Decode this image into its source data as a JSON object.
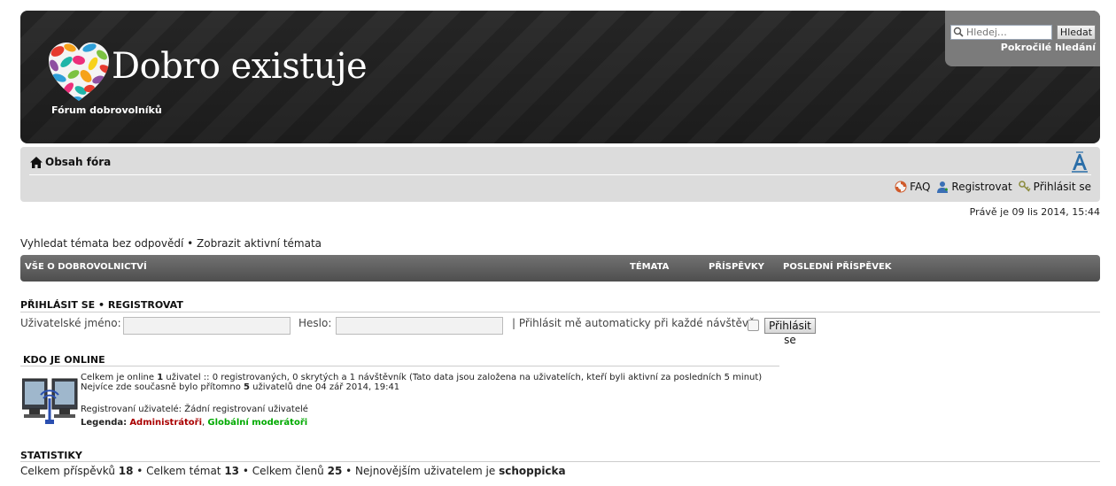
{
  "header": {
    "site_title": "Dobro existuje",
    "site_description": "Fórum dobrovolníků",
    "logo_icon": "heart-logo-icon",
    "search": {
      "placeholder": "Hledej…",
      "button_label": "Hledat",
      "advanced_label": "Pokročilé hledání"
    }
  },
  "navbar": {
    "home_label": "Obsah fóra",
    "links": [
      {
        "icon": "faq-lifebuoy-icon",
        "label": "FAQ"
      },
      {
        "icon": "register-user-icon",
        "label": "Registrovat"
      },
      {
        "icon": "login-key-icon",
        "label": "Přihlásit se"
      }
    ]
  },
  "datetime": "Právě je 09 lis 2014, 15:44",
  "search_links": {
    "unanswered": "Vyhledat témata bez odpovědí",
    "separator": "•",
    "active": "Zobrazit aktivní témata"
  },
  "forum_head": {
    "category": "VŠE O DOBROVOLNICTVÍ",
    "topics": "TÉMATA",
    "posts": "PŘÍSPĚVKY",
    "last_post": "POSLEDNÍ PŘÍSPĚVEK"
  },
  "login": {
    "title_login": "PŘIHLÁSIT SE",
    "title_sep": "•",
    "title_register": "REGISTROVAT",
    "username_label": "Uživatelské jméno:",
    "password_label": "Heslo:",
    "remember_label": "| Přihlásit mě automaticky při každé návštěvě",
    "button_label": "Přihlásit se"
  },
  "online": {
    "title": "KDO JE ONLINE",
    "line1_prefix": "Celkem je online ",
    "line1_count": "1",
    "line1_suffix": " uživatel :: 0 registrovaných, 0 skrytých a 1 návštěvník (Tato data jsou založena na uživatelích, kteří byli aktivní za posledních 5 minut)",
    "line2_prefix": "Nejvíce zde současně bylo přítomno ",
    "line2_count": "5",
    "line2_suffix": " uživatelů dne 04 zář 2014, 19:41",
    "registered_line": "Registrovaní uživatelé: Žádní registrovaní uživatelé",
    "legend_label": "Legenda:",
    "legend_admin": "Administrátoři",
    "legend_comma": ",",
    "legend_gmod": "Globální moderátoři",
    "admin_color": "#aa0000",
    "gmod_color": "#00aa00"
  },
  "stats": {
    "title": "STATISTIKY",
    "posts_label": "Celkem příspěvků ",
    "posts_value": "18",
    "topics_label": " • Celkem témat ",
    "topics_value": "13",
    "members_label": " • Celkem členů ",
    "members_value": "25",
    "newest_label": " • Nejnovějším uživatelem je ",
    "newest_value": "schoppicka"
  }
}
